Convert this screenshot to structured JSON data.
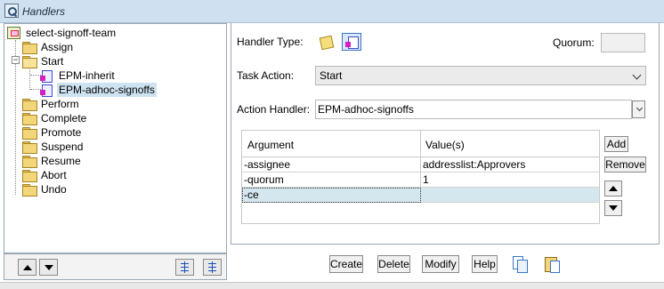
{
  "window": {
    "title": "Handlers"
  },
  "tree": {
    "root": "select-signoff-team",
    "items": [
      {
        "label": "Assign"
      },
      {
        "label": "Start"
      },
      {
        "label": "EPM-inherit"
      },
      {
        "label": "EPM-adhoc-signoffs"
      },
      {
        "label": "Perform"
      },
      {
        "label": "Complete"
      },
      {
        "label": "Promote"
      },
      {
        "label": "Suspend"
      },
      {
        "label": "Resume"
      },
      {
        "label": "Abort"
      },
      {
        "label": "Undo"
      }
    ]
  },
  "form": {
    "handler_type_label": "Handler Type:",
    "quorum_label": "Quorum:",
    "quorum_value": "",
    "task_action_label": "Task Action:",
    "task_action_value": "Start",
    "action_handler_label": "Action Handler:",
    "action_handler_value": "EPM-adhoc-signoffs"
  },
  "table": {
    "headers": [
      "Argument",
      "Value(s)"
    ],
    "rows": [
      {
        "argument": "-assignee",
        "value": "addresslist:Approvers"
      },
      {
        "argument": "-quorum",
        "value": "1"
      },
      {
        "argument": "-ce",
        "value": ""
      }
    ]
  },
  "side_buttons": {
    "add": "Add",
    "remove": "Remove"
  },
  "actions": {
    "create": "Create",
    "delete": "Delete",
    "modify": "Modify",
    "help": "Help"
  }
}
